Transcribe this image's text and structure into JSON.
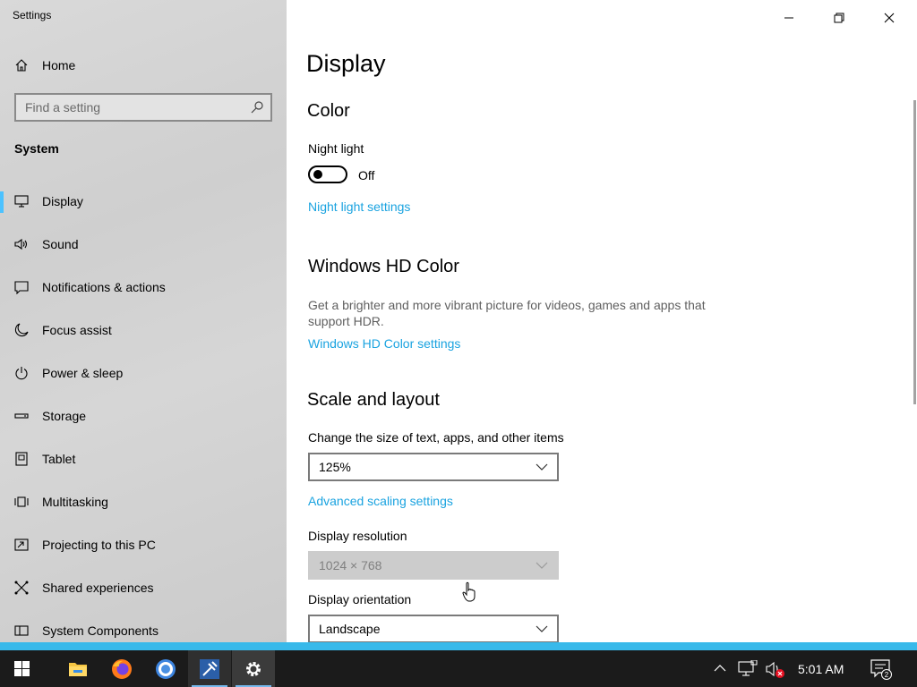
{
  "app": {
    "title": "Settings"
  },
  "sidebar": {
    "home_label": "Home",
    "search": {
      "placeholder": "Find a setting"
    },
    "section_label": "System",
    "items": [
      {
        "label": "Display",
        "icon": "monitor-icon",
        "active": true
      },
      {
        "label": "Sound",
        "icon": "speaker-icon"
      },
      {
        "label": "Notifications & actions",
        "icon": "notification-icon"
      },
      {
        "label": "Focus assist",
        "icon": "moon-icon"
      },
      {
        "label": "Power & sleep",
        "icon": "power-icon"
      },
      {
        "label": "Storage",
        "icon": "storage-icon"
      },
      {
        "label": "Tablet",
        "icon": "tablet-icon"
      },
      {
        "label": "Multitasking",
        "icon": "multitasking-icon"
      },
      {
        "label": "Projecting to this PC",
        "icon": "projecting-icon"
      },
      {
        "label": "Shared experiences",
        "icon": "shared-experiences-icon"
      },
      {
        "label": "System Components",
        "icon": "system-components-icon"
      }
    ]
  },
  "main": {
    "page_title": "Display",
    "color": {
      "heading": "Color",
      "night_light_label": "Night light",
      "night_light_state": "Off",
      "night_light_link": "Night light settings"
    },
    "hd_color": {
      "heading": "Windows HD Color",
      "description": "Get a brighter and more vibrant picture for videos, games and apps that support HDR.",
      "link": "Windows HD Color settings"
    },
    "scale": {
      "heading": "Scale and layout",
      "size_label": "Change the size of text, apps, and other items",
      "size_value": "125%",
      "advanced_link": "Advanced scaling settings",
      "resolution_label": "Display resolution",
      "resolution_value": "1024 × 768",
      "orientation_label": "Display orientation",
      "orientation_value": "Landscape"
    }
  },
  "taskbar": {
    "clock": "5:01 AM",
    "notification_count": "2",
    "apps": [
      "start-icon",
      "file-explorer-icon",
      "firefox-icon",
      "chrome-icon",
      "tool-app-icon",
      "settings-gear-icon"
    ]
  },
  "colors": {
    "accent": "#38b9ea",
    "link": "#1aa3e0",
    "taskbar": "#1b1b1b",
    "sidebar": "#d3d3d3"
  }
}
